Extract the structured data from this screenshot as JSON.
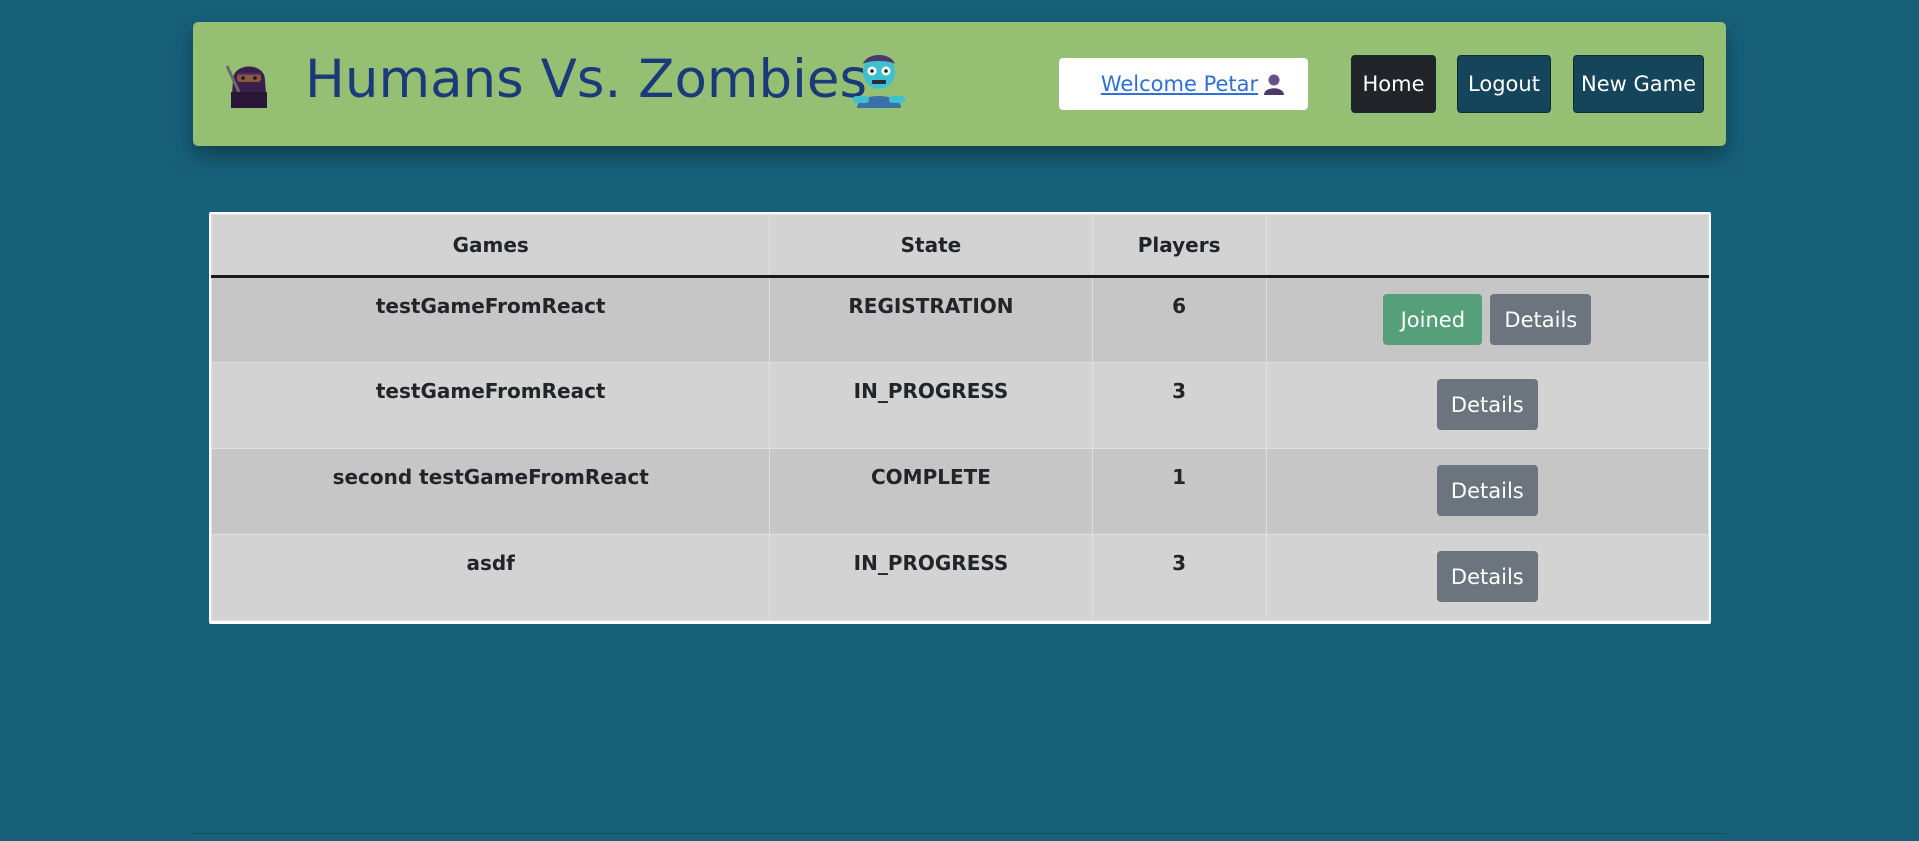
{
  "header": {
    "title": "Humans Vs. Zombies",
    "ninja_icon": "ninja-emoji-icon",
    "zombie_icon": "zombie-emoji-icon",
    "welcome_text": "Welcome Petar",
    "user_icon": "user-silhouette-icon"
  },
  "nav": {
    "home": "Home",
    "logout": "Logout",
    "new_game": "New Game"
  },
  "table": {
    "headers": [
      "Games",
      "State",
      "Players",
      ""
    ],
    "rows": [
      {
        "name": "testGameFromReact",
        "state": "REGISTRATION",
        "players": "6",
        "joined": "Joined",
        "details": "Details"
      },
      {
        "name": "testGameFromReact",
        "state": "IN_PROGRESS",
        "players": "3",
        "details": "Details"
      },
      {
        "name": "second testGameFromReact",
        "state": "COMPLETE",
        "players": "1",
        "details": "Details"
      },
      {
        "name": "asdf",
        "state": "IN_PROGRESS",
        "players": "3",
        "details": "Details"
      }
    ]
  },
  "colors": {
    "background": "#17607a",
    "header_bg": "#95bf72",
    "title_color": "#1b3a7a",
    "joined_btn": "#55a07a",
    "details_btn": "#6c757d"
  }
}
